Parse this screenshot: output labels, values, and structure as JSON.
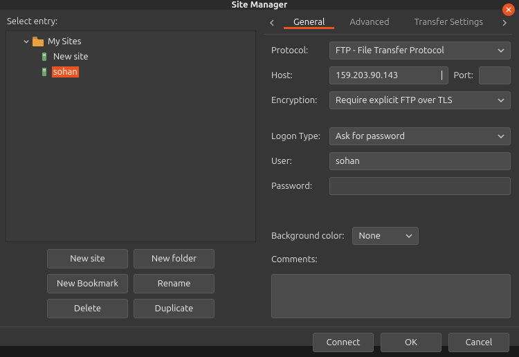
{
  "window": {
    "title": "Site Manager"
  },
  "left": {
    "heading": "Select entry:",
    "tree": {
      "root_label": "My Sites",
      "items": [
        {
          "label": "New site",
          "selected": false
        },
        {
          "label": "sohan",
          "selected": true
        }
      ]
    },
    "buttons": {
      "new_site": "New site",
      "new_folder": "New folder",
      "new_bookmark": "New Bookmark",
      "rename": "Rename",
      "delete": "Delete",
      "duplicate": "Duplicate"
    }
  },
  "right": {
    "tabs": {
      "general": "General",
      "advanced": "Advanced",
      "transfer": "Transfer Settings"
    },
    "labels": {
      "protocol": "Protocol:",
      "host": "Host:",
      "port": "Port:",
      "encryption": "Encryption:",
      "logon_type": "Logon Type:",
      "user": "User:",
      "password": "Password:",
      "background_color": "Background color:",
      "comments": "Comments:"
    },
    "values": {
      "protocol": "FTP - File Transfer Protocol",
      "host": "159.203.90.143",
      "port": "",
      "encryption": "Require explicit FTP over TLS",
      "logon_type": "Ask for password",
      "user": "sohan",
      "password": "",
      "background_color": "None",
      "comments": ""
    }
  },
  "footer": {
    "connect": "Connect",
    "ok": "OK",
    "cancel": "Cancel"
  }
}
